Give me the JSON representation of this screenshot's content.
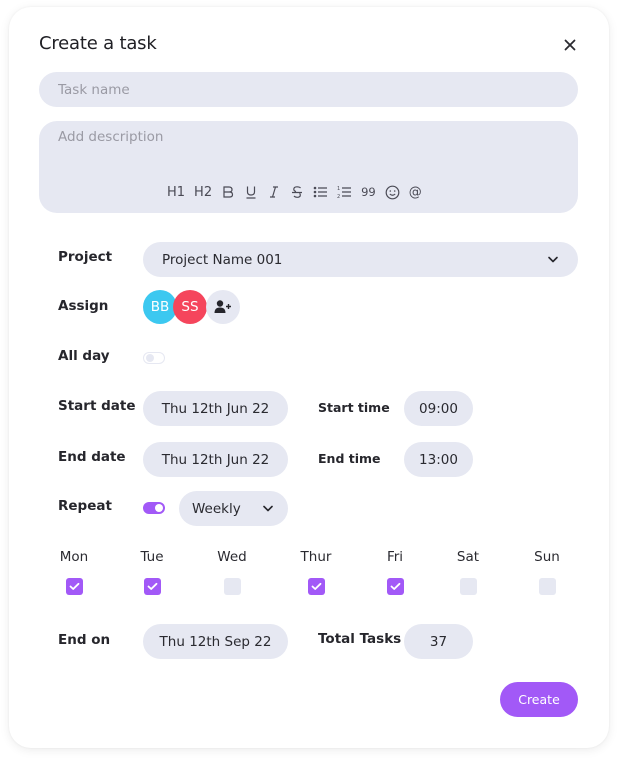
{
  "dialog": {
    "title": "Create a task",
    "close_icon": "close-icon"
  },
  "task_name": {
    "value": "",
    "placeholder": "Task name"
  },
  "description": {
    "value": "",
    "placeholder": "Add description",
    "toolbar": [
      {
        "name": "heading-1",
        "label": "H1"
      },
      {
        "name": "heading-2",
        "label": "H2"
      },
      {
        "name": "bold",
        "label": "B"
      },
      {
        "name": "underline",
        "label": "U"
      },
      {
        "name": "italic",
        "label": "I"
      },
      {
        "name": "strikethrough",
        "label": "S"
      },
      {
        "name": "bullet-list",
        "label": ""
      },
      {
        "name": "numbered-list",
        "label": ""
      },
      {
        "name": "quote",
        "label": "99"
      },
      {
        "name": "emoji",
        "label": ""
      },
      {
        "name": "mention",
        "label": "@"
      }
    ]
  },
  "project": {
    "label": "Project",
    "value": "Project Name 001"
  },
  "assign": {
    "label": "Assign",
    "assignees": [
      {
        "initials": "BB",
        "color": "#3cc8f0"
      },
      {
        "initials": "SS",
        "color": "#f5455c"
      }
    ],
    "add_icon": "add-user-icon"
  },
  "all_day": {
    "label": "All day",
    "enabled": false
  },
  "start_date": {
    "label": "Start date",
    "value": "Thu 12th Jun 22"
  },
  "start_time": {
    "label": "Start time",
    "value": "09:00"
  },
  "end_date": {
    "label": "End date",
    "value": "Thu 12th Jun 22"
  },
  "end_time": {
    "label": "End time",
    "value": "13:00"
  },
  "repeat": {
    "label": "Repeat",
    "enabled": true,
    "frequency": "Weekly"
  },
  "days": [
    {
      "label": "Mon",
      "checked": true
    },
    {
      "label": "Tue",
      "checked": true
    },
    {
      "label": "Wed",
      "checked": false
    },
    {
      "label": "Thur",
      "checked": true
    },
    {
      "label": "Fri",
      "checked": true
    },
    {
      "label": "Sat",
      "checked": false
    },
    {
      "label": "Sun",
      "checked": false
    }
  ],
  "end_on": {
    "label": "End on",
    "value": "Thu 12th Sep 22"
  },
  "total_tasks": {
    "label": "Total Tasks",
    "value": "37"
  },
  "create_label": "Create",
  "colors": {
    "accent": "#a259f7",
    "field_bg": "#e6e8f2",
    "toggle_off": "#e8eaf2"
  }
}
